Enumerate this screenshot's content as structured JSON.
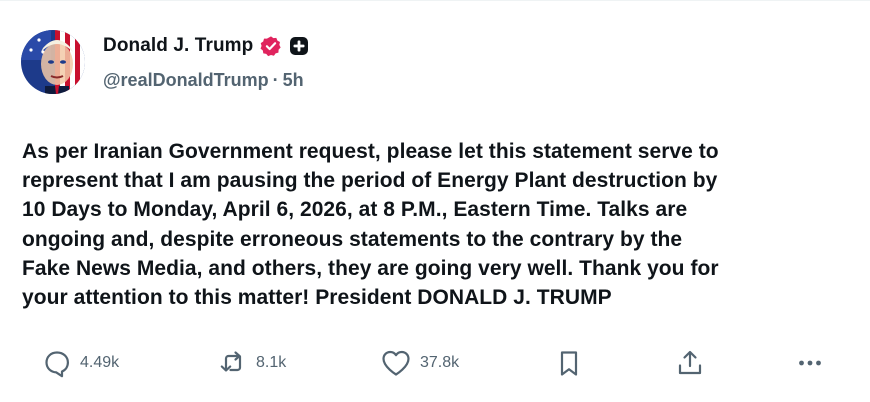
{
  "post": {
    "author": {
      "display_name": "Donald J. Trump",
      "handle": "@realDonaldTrump",
      "separator": "·",
      "time": "5h",
      "verified_badge_color": "#e0245e",
      "avatar_icon": "flag-portrait-avatar"
    },
    "text": "As per Iranian Government request, please let this statement serve to\nrepresent that I am pausing the period of Energy Plant destruction by\n10 Days to Monday, April 6, 2026, at 8 P.M., Eastern Time. Talks are\nongoing and, despite erroneous statements to the contrary by the\nFake News Media, and others, they are going very well. Thank you for\nyour attention to this matter! President DONALD J. TRUMP"
  },
  "actions": {
    "replies": {
      "icon": "reply-icon",
      "count": "4.49k"
    },
    "reposts": {
      "icon": "repost-icon",
      "count": "8.1k"
    },
    "likes": {
      "icon": "heart-icon",
      "count": "37.8k"
    },
    "bookmark": {
      "icon": "bookmark-icon"
    },
    "share": {
      "icon": "share-icon"
    },
    "more": {
      "icon": "more-icon"
    }
  },
  "colors": {
    "text": "#0f1419",
    "secondary": "#536471",
    "verified": "#e0245e"
  }
}
